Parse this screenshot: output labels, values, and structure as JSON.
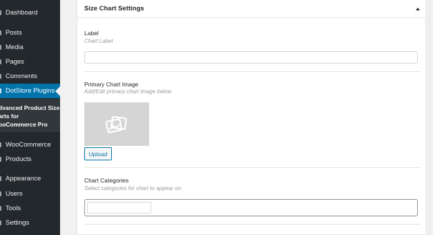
{
  "sidebar": {
    "items": [
      {
        "label": "Dashboard"
      },
      {
        "label": "Posts"
      },
      {
        "label": "Media"
      },
      {
        "label": "Pages"
      },
      {
        "label": "Comments"
      },
      {
        "label": "DotStore Plugins"
      },
      {
        "label": "WooCommerce"
      },
      {
        "label": "Products"
      },
      {
        "label": "Appearance"
      },
      {
        "label": "Users"
      },
      {
        "label": "Tools"
      },
      {
        "label": "Settings"
      }
    ],
    "submenu": [
      "dvanced Product Size",
      "arts for",
      "ooCommerce Pro"
    ],
    "active_color": "#0073aa",
    "bg_color": "#23282d"
  },
  "panel": {
    "title": "Size Chart Settings",
    "label_field": {
      "label": "Label",
      "description": "Chart Label",
      "value": ""
    },
    "image_field": {
      "label": "Primary Chart Image",
      "description": "Add/Edit primary chart image below",
      "upload_label": "Upload",
      "icon": "image-placeholder-icon"
    },
    "categories_field": {
      "label": "Chart Categories",
      "description": "Select categories for chart to appear on.",
      "value": ""
    }
  }
}
